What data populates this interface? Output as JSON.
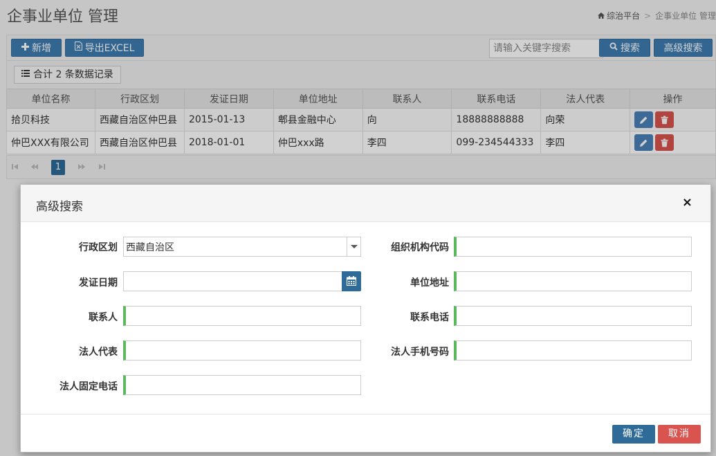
{
  "header": {
    "title": "企事业单位 管理",
    "breadcrumb": [
      "综治平台",
      "企事业单位 管理"
    ]
  },
  "toolbar": {
    "add_label": "新增",
    "export_label": "导出EXCEL",
    "search_placeholder": "请输入关键字搜索",
    "search_label": "搜索",
    "advanced_label": "高级搜索"
  },
  "summary": {
    "count_text": "合计 2 条数据记录"
  },
  "table": {
    "columns": [
      "单位名称",
      "行政区划",
      "发证日期",
      "单位地址",
      "联系人",
      "联系电话",
      "法人代表",
      "操作"
    ],
    "rows": [
      [
        "拾贝科技",
        "西藏自治区仲巴县",
        "2015-01-13",
        "郫县金融中心",
        "向",
        "18888888888",
        "向荣"
      ],
      [
        "仲巴XXX有限公司",
        "西藏自治区仲巴县",
        "2018-01-01",
        "仲巴xxx路",
        "李四",
        "099-234544333",
        "李四"
      ]
    ]
  },
  "pager": {
    "current_page": "1"
  },
  "modal": {
    "title": "高级搜索",
    "close": "×",
    "fields": {
      "region_label": "行政区划",
      "region_value": "西藏自治区",
      "org_code_label": "组织机构代码",
      "issue_date_label": "发证日期",
      "address_label": "单位地址",
      "contact_label": "联系人",
      "phone_label": "联系电话",
      "legal_rep_label": "法人代表",
      "legal_mobile_label": "法人手机号码",
      "legal_fixed_label": "法人固定电话"
    },
    "ok_label": "确定",
    "cancel_label": "取消"
  },
  "colors": {
    "primary": "#2e6b99",
    "danger": "#d9534f",
    "required": "#5cb85c"
  }
}
